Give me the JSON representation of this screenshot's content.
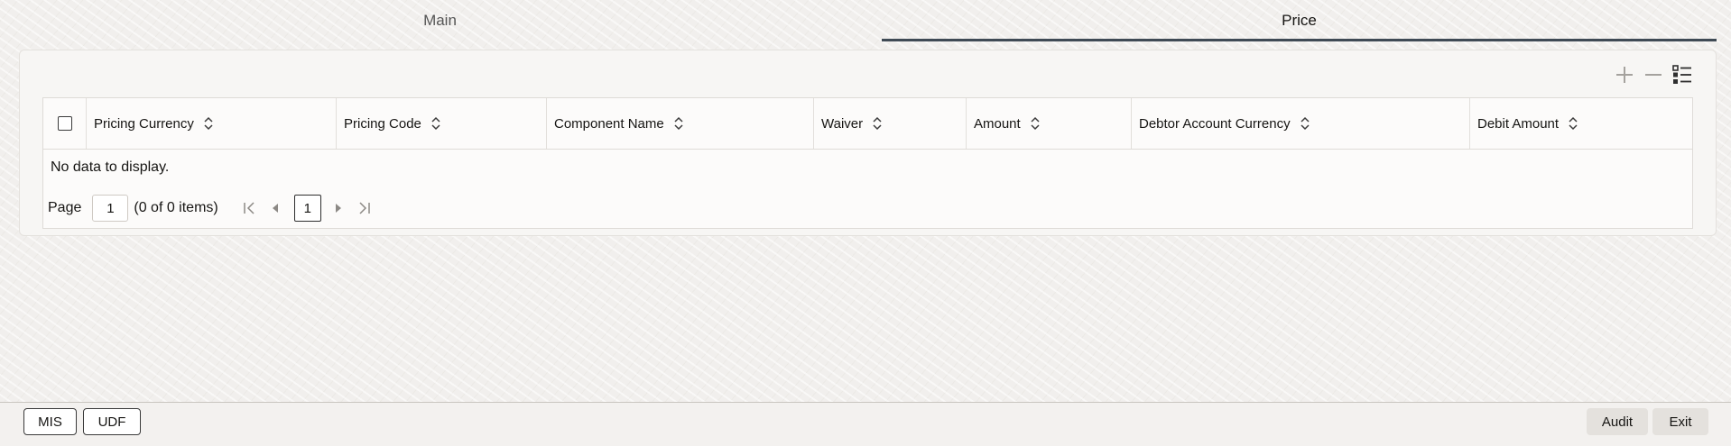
{
  "tabs": [
    {
      "label": "Main",
      "selected": false
    },
    {
      "label": "Price",
      "selected": true
    }
  ],
  "toolbar": {
    "add_icon": "plus-icon",
    "remove_icon": "minus-icon",
    "columns_icon": "list-settings-icon"
  },
  "table": {
    "columns": [
      "Pricing Currency",
      "Pricing Code",
      "Component Name",
      "Waiver",
      "Amount",
      "Debtor Account Currency",
      "Debit Amount"
    ],
    "empty_message": "No data to display."
  },
  "pagination": {
    "label": "Page",
    "page_value": "1",
    "items_text": "(0 of 0 items)",
    "current_page": "1"
  },
  "footer": {
    "mis": "MIS",
    "udf": "UDF",
    "audit": "Audit",
    "exit": "Exit"
  },
  "colors": {
    "tab_indicator": "#3f4a55",
    "text": "#161513",
    "background": "#f1efed"
  }
}
